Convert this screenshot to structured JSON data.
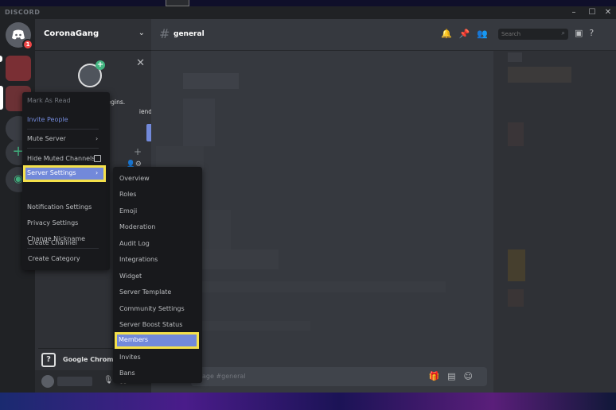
{
  "app": {
    "brand": "DISCORD"
  },
  "window_controls": {
    "minimize": "–",
    "maximize": "☐",
    "close": "✕"
  },
  "guild_bar": {
    "home_badge": "1",
    "add_icon": "+"
  },
  "server": {
    "name": "CoronaGang"
  },
  "invite_card": {
    "line1": "An adventure begins.",
    "line2": "iends!"
  },
  "channel_header": {
    "name": "general"
  },
  "search": {
    "placeholder": "Search"
  },
  "chat": {
    "placeholder": "age #general"
  },
  "context_menu": {
    "items": [
      {
        "label": "Mark As Read"
      },
      {
        "label": "Invite People"
      },
      {
        "label": "Mute Server"
      },
      {
        "label": "Hide Muted Channels"
      },
      {
        "label": "Server Settings"
      },
      {
        "label": "Notification Settings"
      },
      {
        "label": "Privacy Settings"
      },
      {
        "label": "Change Nickname"
      },
      {
        "label": "Create Channel"
      },
      {
        "label": "Create Category"
      }
    ]
  },
  "submenu": {
    "items": [
      {
        "label": "Overview"
      },
      {
        "label": "Roles"
      },
      {
        "label": "Emoji"
      },
      {
        "label": "Moderation"
      },
      {
        "label": "Audit Log"
      },
      {
        "label": "Integrations"
      },
      {
        "label": "Widget"
      },
      {
        "label": "Server Template"
      },
      {
        "label": "Community Settings"
      },
      {
        "label": "Server Boost Status"
      },
      {
        "label": "Members"
      },
      {
        "label": "Invites"
      },
      {
        "label": "Bans"
      }
    ]
  },
  "popup": {
    "label": "Google Chrome",
    "icon": "?"
  },
  "colors": {
    "accent": "#7289da",
    "highlight_outline": "#f4e04a",
    "badge": "#f04747",
    "online": "#43b581"
  }
}
